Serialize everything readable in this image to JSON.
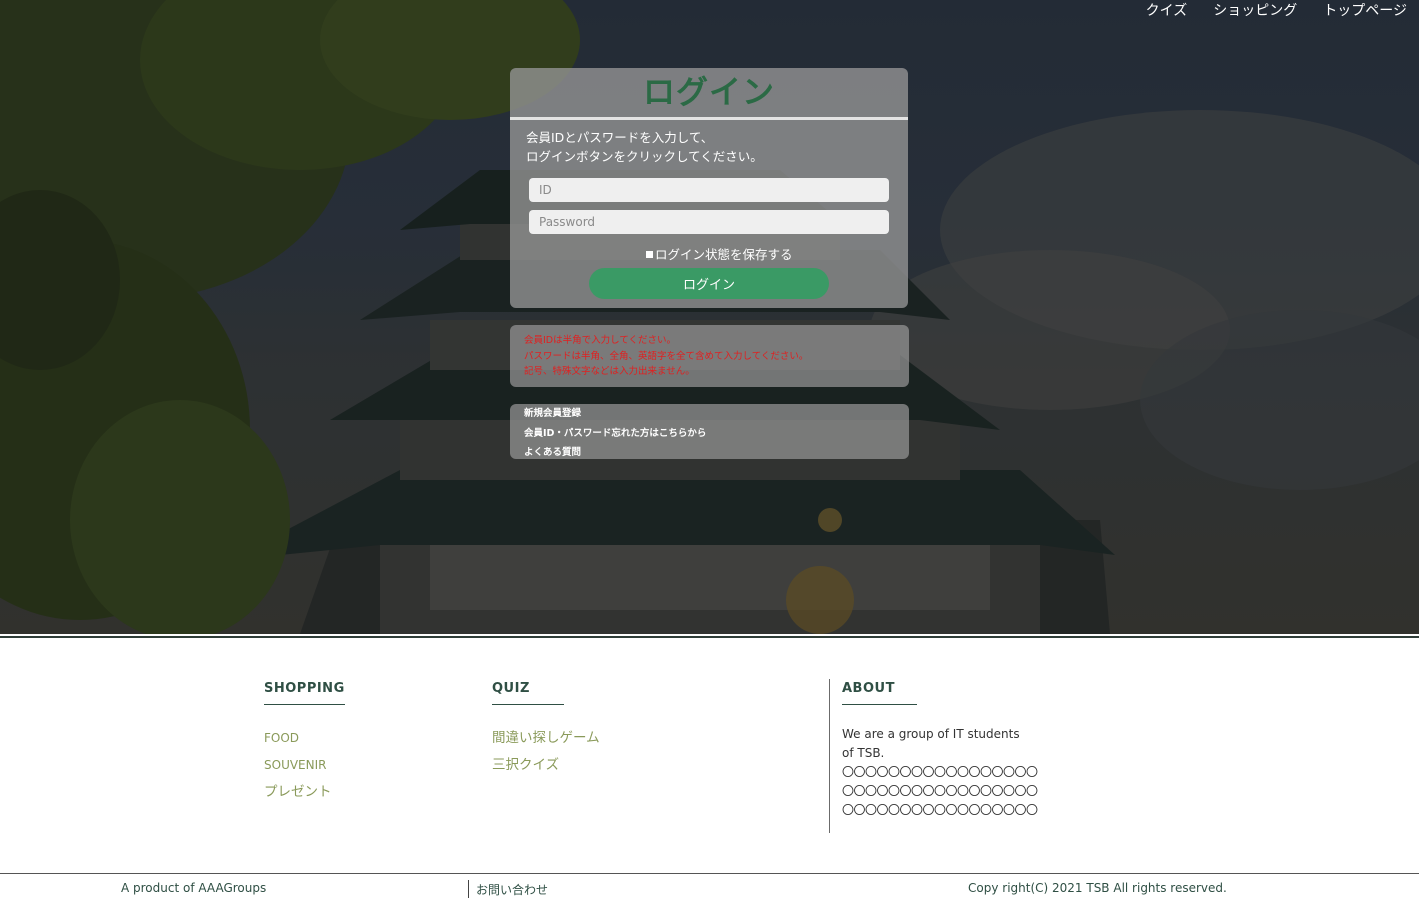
{
  "topnav": {
    "items": [
      "クイズ",
      "ショッピング",
      "トップページ"
    ]
  },
  "login": {
    "title": "ログイン",
    "instructions": [
      "会員IDとパスワードを入力して、",
      "ログインボタンをクリックしてください。"
    ],
    "id_placeholder": "ID",
    "password_placeholder": "Password",
    "remember_label": "ログイン状態を保存する",
    "button_label": "ログイン"
  },
  "notice": {
    "lines": [
      "会員IDは半角で入力してください。",
      "パスワードは半角、全角、英語字を全て含めて入力してください。",
      "記号、特殊文字などは入力出来ません。"
    ]
  },
  "help_links": [
    "新規会員登録",
    "会員ID・パスワード忘れた方はこちらから",
    "よくある質問"
  ],
  "footer": {
    "shopping": {
      "heading": "SHOPPING",
      "links": [
        "FOOD",
        "SOUVENIR",
        "プレゼント"
      ]
    },
    "quiz": {
      "heading": "QUIZ",
      "links": [
        "間違い探しゲーム",
        "三択クイズ"
      ]
    },
    "about": {
      "heading": "ABOUT",
      "lines": [
        "We are a group of IT students of TSB.",
        "〇〇〇〇〇〇〇〇〇〇〇〇〇〇〇〇〇",
        "〇〇〇〇〇〇〇〇〇〇〇〇〇〇〇〇〇",
        "〇〇〇〇〇〇〇〇〇〇〇〇〇〇〇〇〇"
      ]
    },
    "bottom": {
      "product": "A product of AAAGroups",
      "contact": "お問い合わせ",
      "copyright": "Copy right(C) 2021 TSB All rights reserved."
    }
  },
  "colors": {
    "accent_green": "#3a9a65",
    "title_green": "#2b6a45",
    "error_red": "#e02020",
    "footer_link": "#8a9a5a"
  }
}
